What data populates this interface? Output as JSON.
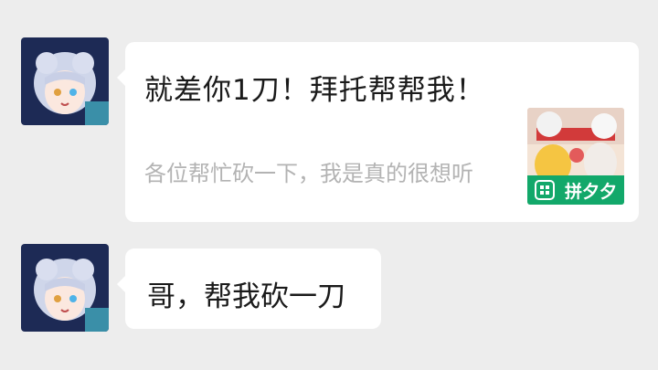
{
  "messages": [
    {
      "kind": "share-card",
      "title": "就差你1刀！拜托帮帮我！",
      "description": "各位帮忙砍一下，我是真的很想听",
      "app_label": "拼夕夕"
    },
    {
      "kind": "text",
      "text": "哥，帮我砍一刀"
    }
  ],
  "colors": {
    "background": "#ededed",
    "bubble": "#ffffff",
    "app_green": "#12a86a"
  }
}
